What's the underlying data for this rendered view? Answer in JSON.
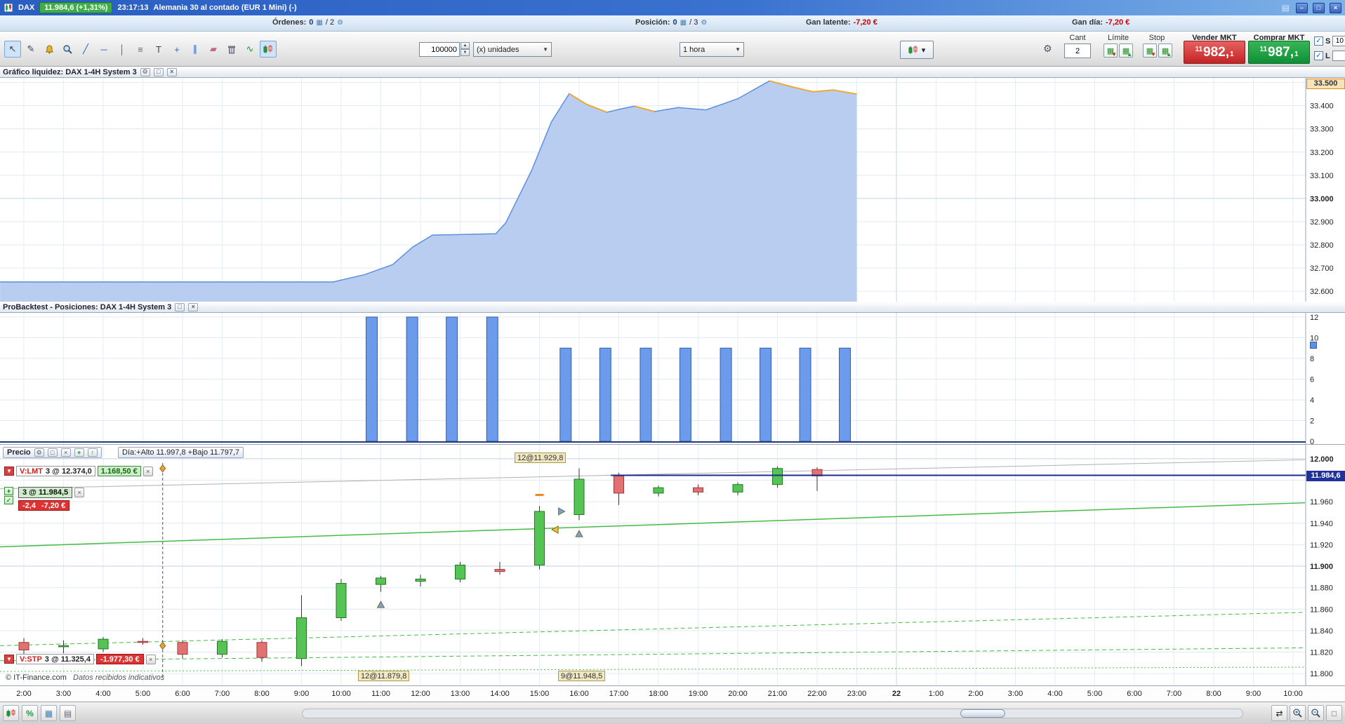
{
  "titlebar": {
    "symbol": "DAX",
    "price_badge": "11.984,6 (+1,31%)",
    "time": "23:17:13",
    "description": "Alemania 30 al contado (EUR 1 Mini) (-)",
    "minimize": "–",
    "maximize": "□",
    "close": "×"
  },
  "infobar": {
    "orders_label": "Órdenes:",
    "orders_value": "0",
    "orders_max": "/ 2",
    "position_label": "Posición:",
    "position_value": "0",
    "position_max": "/ 3",
    "latent_label": "Gan latente:",
    "latent_value": "-7,20 €",
    "day_label": "Gan día:",
    "day_value": "-7,20 €"
  },
  "toolbar": {
    "quantity_value": "100000",
    "units_value": "(x) unidades",
    "timeframe_value": "1 hora",
    "trade": {
      "qty_label": "Cant",
      "qty_value": "2",
      "limit_label": "Límite",
      "stop_label": "Stop",
      "sell_label": "Vender MKT",
      "buy_label": "Comprar MKT",
      "sell_price_small1": "11",
      "sell_price_big": "982,",
      "sell_price_small2": "1",
      "buy_price_small1": "11",
      "buy_price_big": "987,",
      "buy_price_small2": "1",
      "s_label": "S",
      "s_value": "10",
      "l_label": "L",
      "l_value": ""
    }
  },
  "panels": {
    "liquidity": {
      "title": "Gráfico liquidez: DAX 1-4H System 3",
      "badge": "33.500"
    },
    "backtest": {
      "title": "ProBacktest - Posiciones: DAX 1-4H System 3"
    },
    "price": {
      "title": "Precio",
      "day_info": "Día:+Alto 11.997,8 +Bajo 11.797,7",
      "current_price": "11.984,6",
      "order_limit_tag": "V:LMT",
      "order_limit_text": "3 @ 12.374,0",
      "order_limit_pnl": "1.168,50 €",
      "position_text": "3 @ 11.984,5",
      "position_pnl_points": "-2,4",
      "position_pnl": "-7,20 €",
      "order_stop_tag": "V:STP",
      "order_stop_text": "3 @ 11.325,4",
      "order_stop_pnl": "-1.977,30 €",
      "annotation_top": "12@11.929,8",
      "annotation_entry1": "12@11.879,8",
      "annotation_entry2": "9@11.948,5"
    }
  },
  "footer": {
    "copyright": "© IT-Finance.com",
    "disclaimer": "Datos recibidos indicativos"
  },
  "icons": {
    "cursor": "↖",
    "pencil": "✎",
    "trendline": "╱",
    "hline": "─",
    "vline": "│",
    "levels": "≡",
    "text_tool": "T",
    "cross": "+",
    "parallel": "∥",
    "eraser": "▰",
    "wave": "∿",
    "dropdown": "▾",
    "spin_up": "▲",
    "spin_down": "▼",
    "check": "✓",
    "gear": "⚙",
    "window": "□",
    "close": "×",
    "plus": "+",
    "uparrow": "↑",
    "keyboard": "▤",
    "grid": "▦",
    "list": "▤",
    "percent": "%",
    "pan": "⇄",
    "mini_doc": "▤",
    "arr_dn": "▼",
    "arr_up": "▲"
  },
  "colors": {
    "accent_blue": "#2a5ec2",
    "sell_red": "#c22424",
    "buy_green": "#0f8f36",
    "price_line": "#1c2b96",
    "area_fill": "#b9cdf0",
    "orange": "#f5a623"
  },
  "xaxis": {
    "labels": [
      "2:00",
      "3:00",
      "4:00",
      "5:00",
      "6:00",
      "7:00",
      "8:00",
      "9:00",
      "10:00",
      "11:00",
      "12:00",
      "13:00",
      "14:00",
      "15:00",
      "16:00",
      "17:00",
      "18:00",
      "19:00",
      "20:00",
      "21:00",
      "22:00",
      "23:00",
      "22",
      "1:00",
      "2:00",
      "3:00",
      "4:00",
      "5:00",
      "6:00",
      "7:00",
      "8:00",
      "9:00",
      "10:00"
    ],
    "bold_index": 22
  },
  "chart_data": [
    {
      "type": "area",
      "title": "Gráfico liquidez: DAX 1-4H System 3",
      "ylim": [
        32555,
        33520
      ],
      "yticks": [
        {
          "v": 33500,
          "label": "33.500"
        },
        {
          "v": 33400,
          "label": "33.400"
        },
        {
          "v": 33300,
          "label": "33.300"
        },
        {
          "v": 33200,
          "label": "33.200"
        },
        {
          "v": 33100,
          "label": "33.100"
        },
        {
          "v": 33000,
          "label": "33.000",
          "bold": true
        },
        {
          "v": 32900,
          "label": "32.900"
        },
        {
          "v": 32800,
          "label": "32.800"
        },
        {
          "v": 32700,
          "label": "32.700"
        },
        {
          "v": 32600,
          "label": "32.600"
        }
      ],
      "points": [
        [
          1.4,
          32640
        ],
        [
          9.8,
          32640
        ],
        [
          10.6,
          32672
        ],
        [
          11.3,
          32715
        ],
        [
          11.8,
          32790
        ],
        [
          12.3,
          32842
        ],
        [
          13.9,
          32848
        ],
        [
          14.15,
          32895
        ],
        [
          14.8,
          33120
        ],
        [
          15.3,
          33330
        ],
        [
          15.75,
          33452
        ],
        [
          16.2,
          33405
        ],
        [
          16.7,
          33372
        ],
        [
          17.1,
          33388
        ],
        [
          17.4,
          33398
        ],
        [
          17.9,
          33375
        ],
        [
          18.5,
          33392
        ],
        [
          19.2,
          33382
        ],
        [
          20.0,
          33430
        ],
        [
          20.8,
          33507
        ],
        [
          21.4,
          33480
        ],
        [
          21.9,
          33460
        ],
        [
          22.4,
          33468
        ],
        [
          23,
          33450
        ]
      ],
      "orange_ranges": [
        [
          15.75,
          16.7
        ],
        [
          17.4,
          17.9
        ],
        [
          20.8,
          23
        ]
      ],
      "fill_color": "#b9cdf0",
      "line_color": "#5c8fdd",
      "alt_color": "#f5a623"
    },
    {
      "type": "bar",
      "title": "ProBacktest - Posiciones: DAX 1-4H System 3",
      "ylim": [
        0,
        12.4
      ],
      "yticks": [
        {
          "v": 12,
          "label": "12"
        },
        {
          "v": 10,
          "label": "10"
        },
        {
          "v": 8,
          "label": "8"
        },
        {
          "v": 6,
          "label": "6"
        },
        {
          "v": 4,
          "label": "4"
        },
        {
          "v": 2,
          "label": "2"
        },
        {
          "v": 0,
          "label": "0"
        }
      ],
      "bars": [
        [
          10.77,
          12
        ],
        [
          11.79,
          12
        ],
        [
          12.79,
          12
        ],
        [
          13.81,
          12
        ],
        [
          15.66,
          9
        ],
        [
          16.66,
          9
        ],
        [
          17.68,
          9
        ],
        [
          18.68,
          9
        ],
        [
          19.7,
          9
        ],
        [
          20.7,
          9
        ],
        [
          21.7,
          9
        ],
        [
          22.7,
          9
        ]
      ],
      "bar_color": "#6b9bea",
      "bar_border": "#2f5fae"
    },
    {
      "type": "candlestick",
      "title": "Precio",
      "ylim": [
        11789,
        12013
      ],
      "yticks": [
        {
          "v": 12000,
          "label": "12.000",
          "bold": true
        },
        {
          "v": 11960,
          "label": "11.960"
        },
        {
          "v": 11940,
          "label": "11.940"
        },
        {
          "v": 11920,
          "label": "11.920"
        },
        {
          "v": 11900,
          "label": "11.900",
          "bold": true
        },
        {
          "v": 11880,
          "label": "11.880"
        },
        {
          "v": 11860,
          "label": "11.860"
        },
        {
          "v": 11840,
          "label": "11.840"
        },
        {
          "v": 11820,
          "label": "11.820"
        },
        {
          "v": 11800,
          "label": "11.800"
        }
      ],
      "grid_values": [
        12000,
        11980,
        11960,
        11940,
        11920,
        11900,
        11880,
        11860,
        11840,
        11820,
        11800
      ],
      "candles": [
        [
          2,
          11829,
          11833,
          11817,
          11822
        ],
        [
          3,
          11825,
          11831,
          11819,
          11826
        ],
        [
          4,
          11823,
          11834,
          11820,
          11832
        ],
        [
          5,
          11830,
          11833,
          11827,
          11829
        ],
        [
          6,
          11829,
          11831,
          11814,
          11818
        ],
        [
          7,
          11818,
          11832,
          11815,
          11830
        ],
        [
          8,
          11829,
          11831,
          11811,
          11815
        ],
        [
          9,
          11814,
          11873,
          11807,
          11852
        ],
        [
          10,
          11852,
          11888,
          11849,
          11884
        ],
        [
          11,
          11883,
          11891,
          11876,
          11889
        ],
        [
          12,
          11886,
          11892,
          11881,
          11888
        ],
        [
          13,
          11888,
          11904,
          11885,
          11901
        ],
        [
          14,
          11897,
          11904,
          11892,
          11895
        ],
        [
          15,
          11901,
          11956,
          11897,
          11951
        ],
        [
          16,
          11948,
          11991,
          11943,
          11981
        ],
        [
          17,
          11984,
          11987,
          11957,
          11968
        ],
        [
          18,
          11968,
          11975,
          11965,
          11973
        ],
        [
          19,
          11973,
          11976,
          11966,
          11969
        ],
        [
          20,
          11969,
          11978,
          11966,
          11976
        ],
        [
          21,
          11976,
          11993,
          11973,
          11991
        ],
        [
          22,
          11990,
          11992,
          11970,
          11984
        ]
      ],
      "up_color": "#55c455",
      "down_color": "#e07272",
      "current_price": 11984.6,
      "price_line": {
        "value": 11984.6,
        "from": 16.8,
        "color": "#1c2b96"
      },
      "trend_lines": [
        {
          "x": [
            1.4,
            34.3
          ],
          "y": [
            11972,
            11999
          ],
          "color": "#b0b0b0",
          "style": "solid",
          "width": 1
        },
        {
          "x": [
            1.4,
            34.3
          ],
          "y": [
            11918,
            11959
          ],
          "color": "#44bb44",
          "style": "solid",
          "width": 1.5
        },
        {
          "x": [
            1.4,
            34.3
          ],
          "y": [
            11826,
            11857
          ],
          "color": "#44bb44",
          "style": "dashed",
          "width": 1
        },
        {
          "x": [
            1.4,
            34.3
          ],
          "y": [
            11812,
            11824
          ],
          "color": "#44bb44",
          "style": "dashed",
          "width": 1
        },
        {
          "x": [
            1.4,
            34.3
          ],
          "y": [
            11802,
            11806
          ],
          "color": "#44bb44",
          "style": "dotted",
          "width": 1
        }
      ],
      "vline": {
        "t": 5.5,
        "v_top": 11996,
        "v_bot": 11794
      },
      "markers": [
        {
          "shape": "diamond",
          "t": 5.5,
          "v": 11991,
          "color": "#f0a030"
        },
        {
          "shape": "diamond",
          "t": 5.5,
          "v": 11826,
          "color": "#f0a030"
        },
        {
          "shape": "dash",
          "t": 15,
          "v": 11966,
          "color": "#f08820"
        },
        {
          "shape": "left",
          "t": 15.4,
          "v": 11934,
          "color": "#e8c23a"
        },
        {
          "shape": "right",
          "t": 15.55,
          "v": 11951,
          "color": "#6aa5e0"
        },
        {
          "shape": "up",
          "t": 11,
          "v": 11864,
          "color": "#6aa5e0"
        },
        {
          "shape": "up",
          "t": 16,
          "v": 11930,
          "color": "#6aa5e0"
        }
      ]
    }
  ]
}
